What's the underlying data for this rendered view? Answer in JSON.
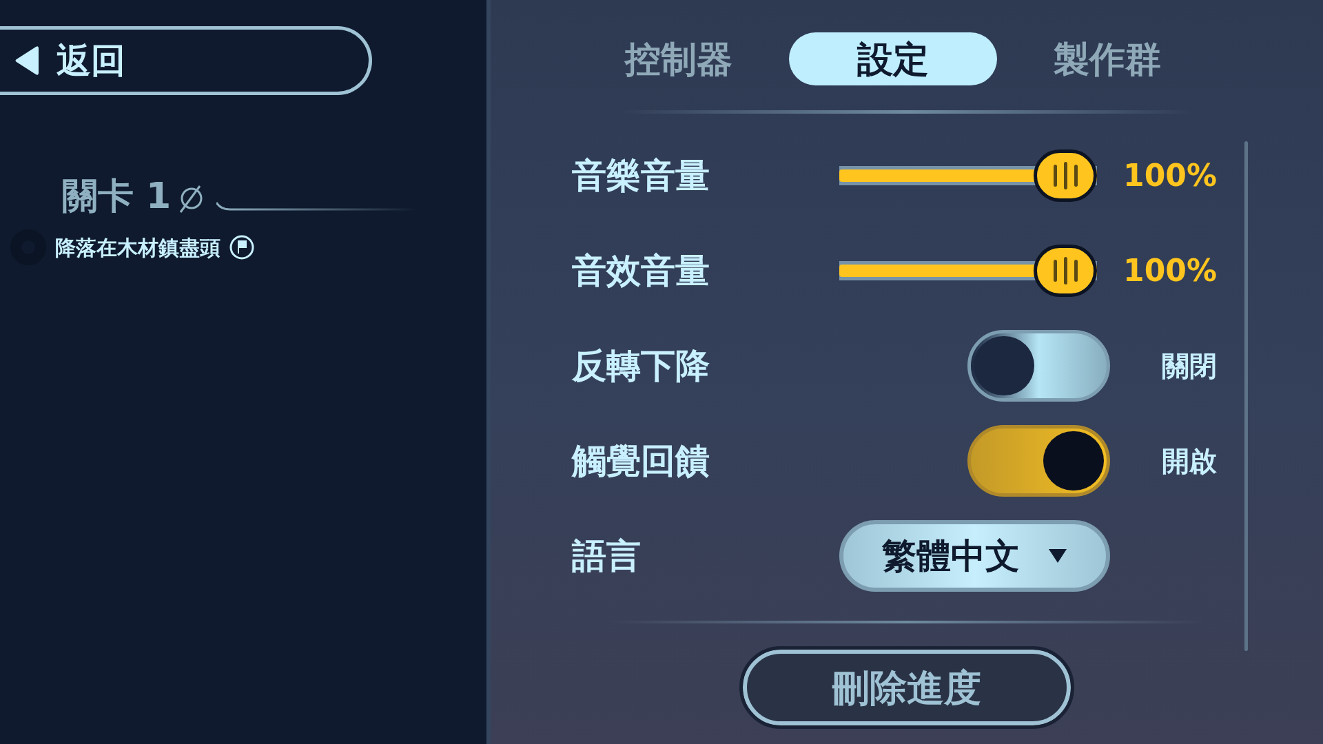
{
  "back_button": {
    "label": "返回"
  },
  "level": {
    "title": "關卡 1",
    "objective": "降落在木材鎮盡頭"
  },
  "tabs": [
    {
      "label": "控制器",
      "selected": false
    },
    {
      "label": "設定",
      "selected": true
    },
    {
      "label": "製作群",
      "selected": false
    }
  ],
  "settings": [
    {
      "kind": "slider",
      "label": "音樂音量",
      "level": 1,
      "reading": "100%"
    },
    {
      "kind": "slider",
      "label": "音效音量",
      "level": 1,
      "reading": "100%"
    },
    {
      "kind": "toggle",
      "label": "反轉下降",
      "on": false,
      "reading": "關閉"
    },
    {
      "kind": "toggle",
      "label": "觸覺回饋",
      "on": true,
      "reading": "開啟"
    },
    {
      "kind": "dropdown",
      "label": "語言",
      "value": "繁體中文"
    }
  ],
  "delete_button": {
    "label": "刪除進度"
  }
}
